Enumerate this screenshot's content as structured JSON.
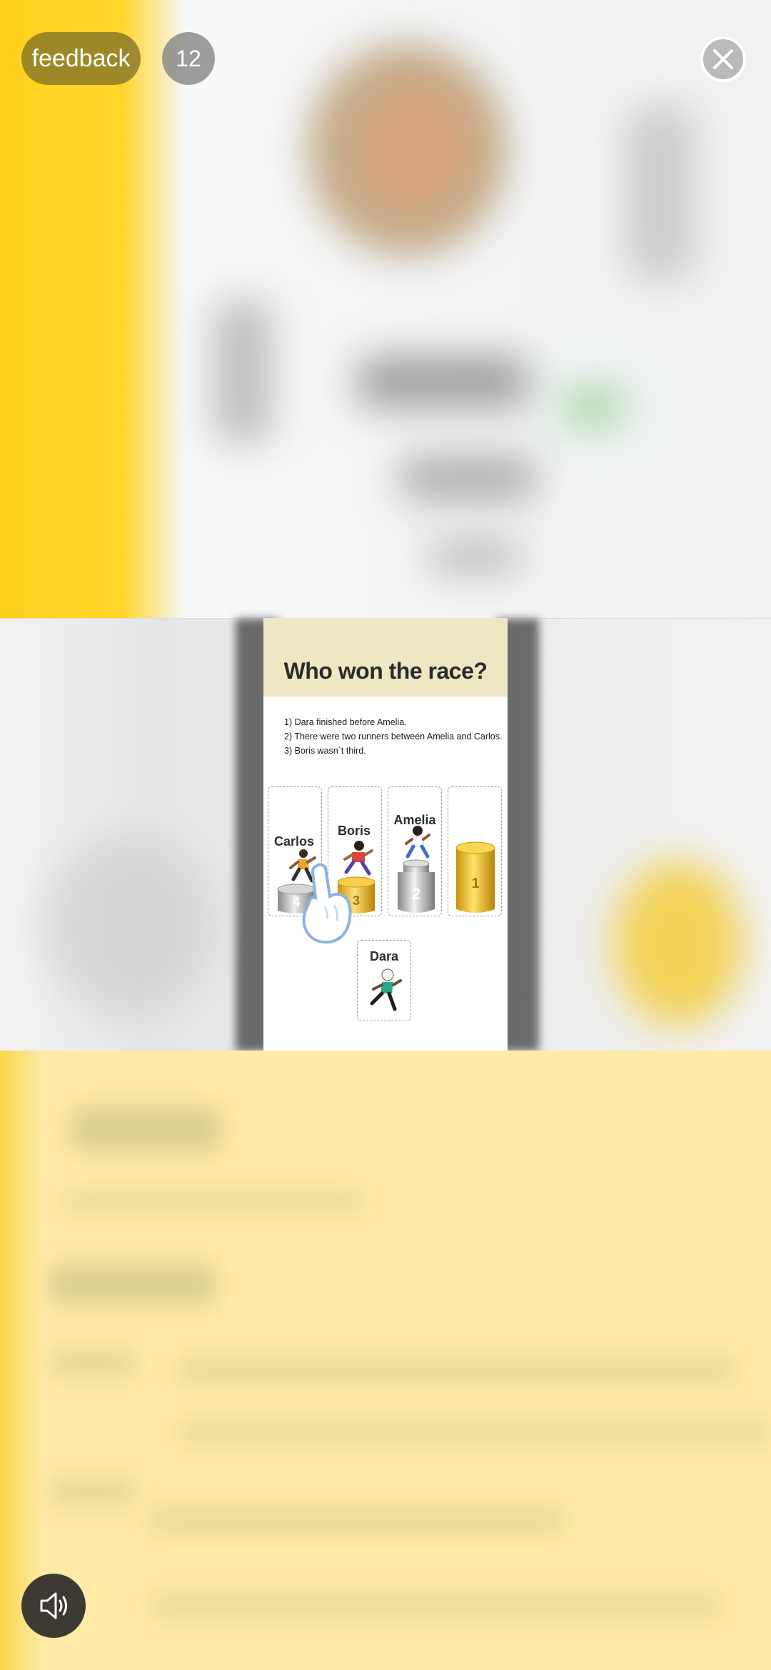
{
  "header": {
    "feedback_label": "feedback",
    "question_count": "12"
  },
  "game": {
    "title": "Who won the race?",
    "clues": [
      "1) Dara finished before Amelia.",
      "2) There were two runners between Amelia and Carlos.",
      "3) Boris wasn`t third."
    ],
    "slots": [
      {
        "runner": "Carlos",
        "podium_label": "4",
        "podium_color": "silver"
      },
      {
        "runner": "Boris",
        "podium_label": "3",
        "podium_color": "gold"
      },
      {
        "runner": "Amelia",
        "podium_label": "2",
        "podium_color": "silver"
      },
      {
        "runner": "",
        "podium_label": "1",
        "podium_color": "gold"
      }
    ],
    "unplaced_runner": "Dara"
  },
  "icons": {
    "close": "close-icon",
    "sound": "speaker-icon",
    "hand": "pointing-hand-icon"
  },
  "colors": {
    "accent_yellow": "#ffd21f",
    "card_header": "#efe6c3",
    "gold": "#f2c21a",
    "silver": "#a8a8a8"
  }
}
